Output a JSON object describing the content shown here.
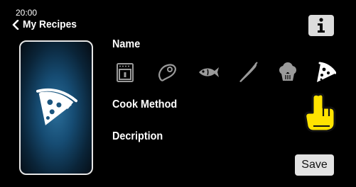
{
  "header": {
    "time": "20:00",
    "title": "My Recipes"
  },
  "labels": {
    "name": "Name",
    "cook_method": "Cook Method",
    "description": "Decription"
  },
  "categories": [
    {
      "name": "oven-icon"
    },
    {
      "name": "meat-icon"
    },
    {
      "name": "fish-icon"
    },
    {
      "name": "vegetable-icon"
    },
    {
      "name": "cake-icon"
    },
    {
      "name": "pizza-icon",
      "selected": true
    }
  ],
  "preview": {
    "icon": "pizza-icon"
  },
  "buttons": {
    "save": "Save",
    "info_icon": "info-icon"
  },
  "colors": {
    "background": "#000000",
    "preview_glow": "#2b6f9b",
    "cursor_hand": "#ffe300"
  }
}
